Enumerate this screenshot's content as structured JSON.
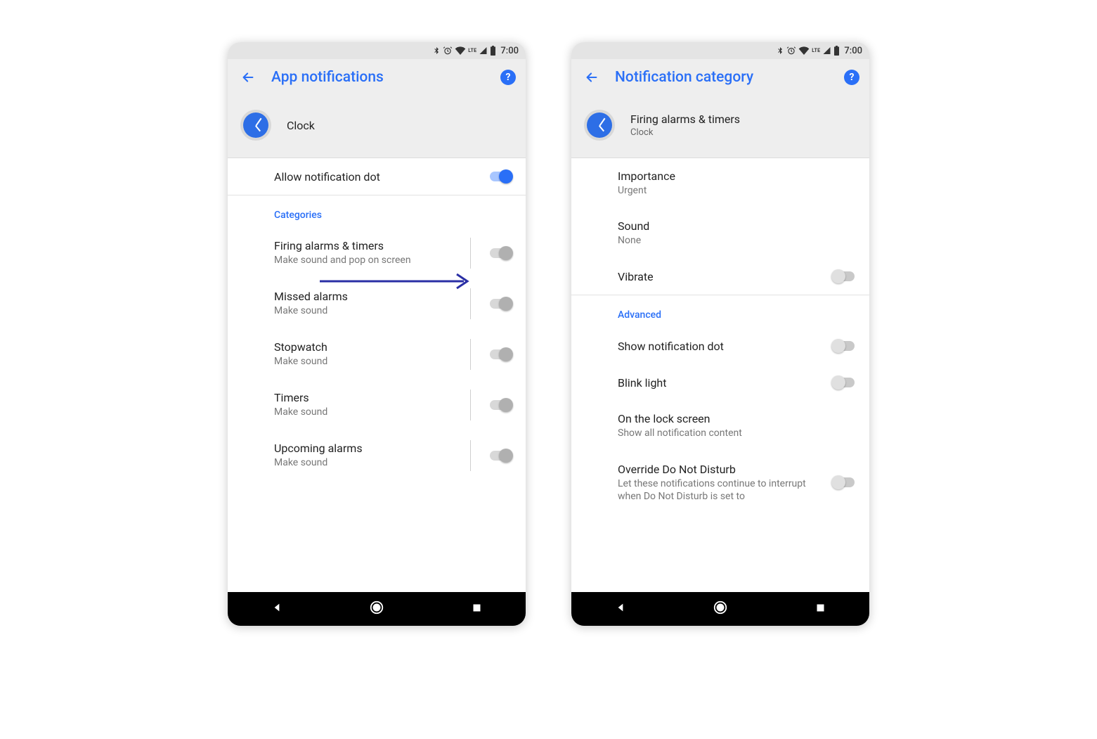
{
  "status": {
    "time": "7:00",
    "lte": "LTE"
  },
  "colors": {
    "accent": "#2a6ff7"
  },
  "screen1": {
    "title": "App notifications",
    "app_name": "Clock",
    "allow_dot": "Allow notification dot",
    "categories_header": "Categories",
    "categories": [
      {
        "title": "Firing alarms & timers",
        "sub": "Make sound and pop on screen"
      },
      {
        "title": "Missed alarms",
        "sub": "Make sound"
      },
      {
        "title": "Stopwatch",
        "sub": "Make sound"
      },
      {
        "title": "Timers",
        "sub": "Make sound"
      },
      {
        "title": "Upcoming alarms",
        "sub": "Make sound"
      }
    ]
  },
  "screen2": {
    "title": "Notification category",
    "channel_name": "Firing alarms & timers",
    "channel_sub": "Clock",
    "importance_label": "Importance",
    "importance_value": "Urgent",
    "sound_label": "Sound",
    "sound_value": "None",
    "vibrate_label": "Vibrate",
    "advanced_header": "Advanced",
    "show_dot": "Show notification dot",
    "blink": "Blink light",
    "lock_label": "On the lock screen",
    "lock_value": "Show all notification content",
    "dnd_label": "Override Do Not Disturb",
    "dnd_sub": "Let these notifications continue to interrupt when Do Not Disturb is set to"
  }
}
